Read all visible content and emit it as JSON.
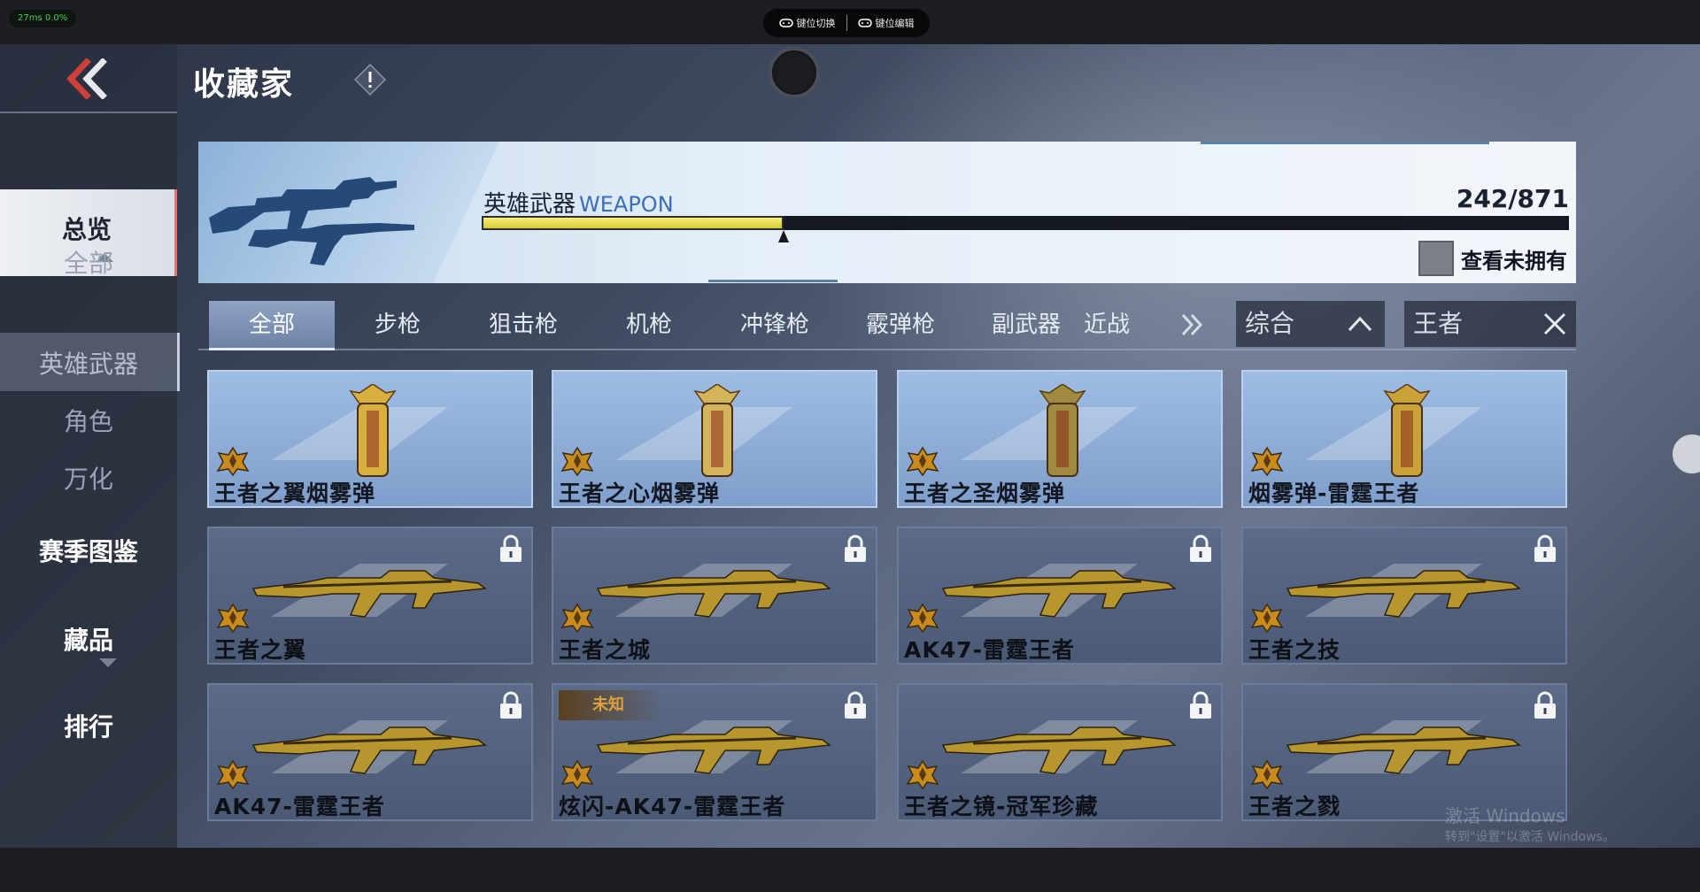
{
  "emulator": {
    "perf": "27ms 0.0%",
    "key_switch": "键位切换",
    "key_edit": "键位编辑"
  },
  "header": {
    "title": "收藏家"
  },
  "sidebar": {
    "items": [
      {
        "label": "总览"
      },
      {
        "label": "全部"
      },
      {
        "label": "英雄武器"
      },
      {
        "label": "角色"
      },
      {
        "label": "万化"
      },
      {
        "label": "赛季图鉴"
      },
      {
        "label": "藏品"
      },
      {
        "label": "排行"
      }
    ]
  },
  "banner": {
    "label_cn": "英雄武器",
    "label_en": "WEAPON",
    "count": "242/871",
    "progress": 0.2779,
    "unowned_label": "查看未拥有"
  },
  "tabs": [
    {
      "label": "全部"
    },
    {
      "label": "步枪"
    },
    {
      "label": "狙击枪"
    },
    {
      "label": "机枪"
    },
    {
      "label": "冲锋枪"
    },
    {
      "label": "霰弹枪"
    },
    {
      "label": "副武器"
    },
    {
      "label": "近战"
    }
  ],
  "filters": {
    "sort": "综合",
    "search": "王者"
  },
  "cards": [
    {
      "name": "王者之翼烟雾弹",
      "locked": false
    },
    {
      "name": "王者之心烟雾弹",
      "locked": false
    },
    {
      "name": "王者之圣烟雾弹",
      "locked": false
    },
    {
      "name": "烟雾弹-雷霆王者",
      "locked": false
    },
    {
      "name": "王者之翼",
      "locked": true
    },
    {
      "name": "王者之城",
      "locked": true
    },
    {
      "name": "AK47-雷霆王者",
      "locked": true
    },
    {
      "name": "王者之技",
      "locked": true
    },
    {
      "name": "AK47-雷霆王者",
      "locked": true
    },
    {
      "name": "炫闪-AK47-雷霆王者",
      "locked": true,
      "tag": "未知"
    },
    {
      "name": "王者之镜-冠军珍藏",
      "locked": true
    },
    {
      "name": "王者之戮",
      "locked": true
    }
  ],
  "watermark": {
    "line1": "激活 Windows",
    "line2": "转到\"设置\"以激活 Windows。"
  },
  "colors": {
    "progress_fill": "#e7dc50",
    "accent_red": "#d0403a",
    "card_unlocked": "#8fadd8",
    "card_locked": "#526280"
  }
}
